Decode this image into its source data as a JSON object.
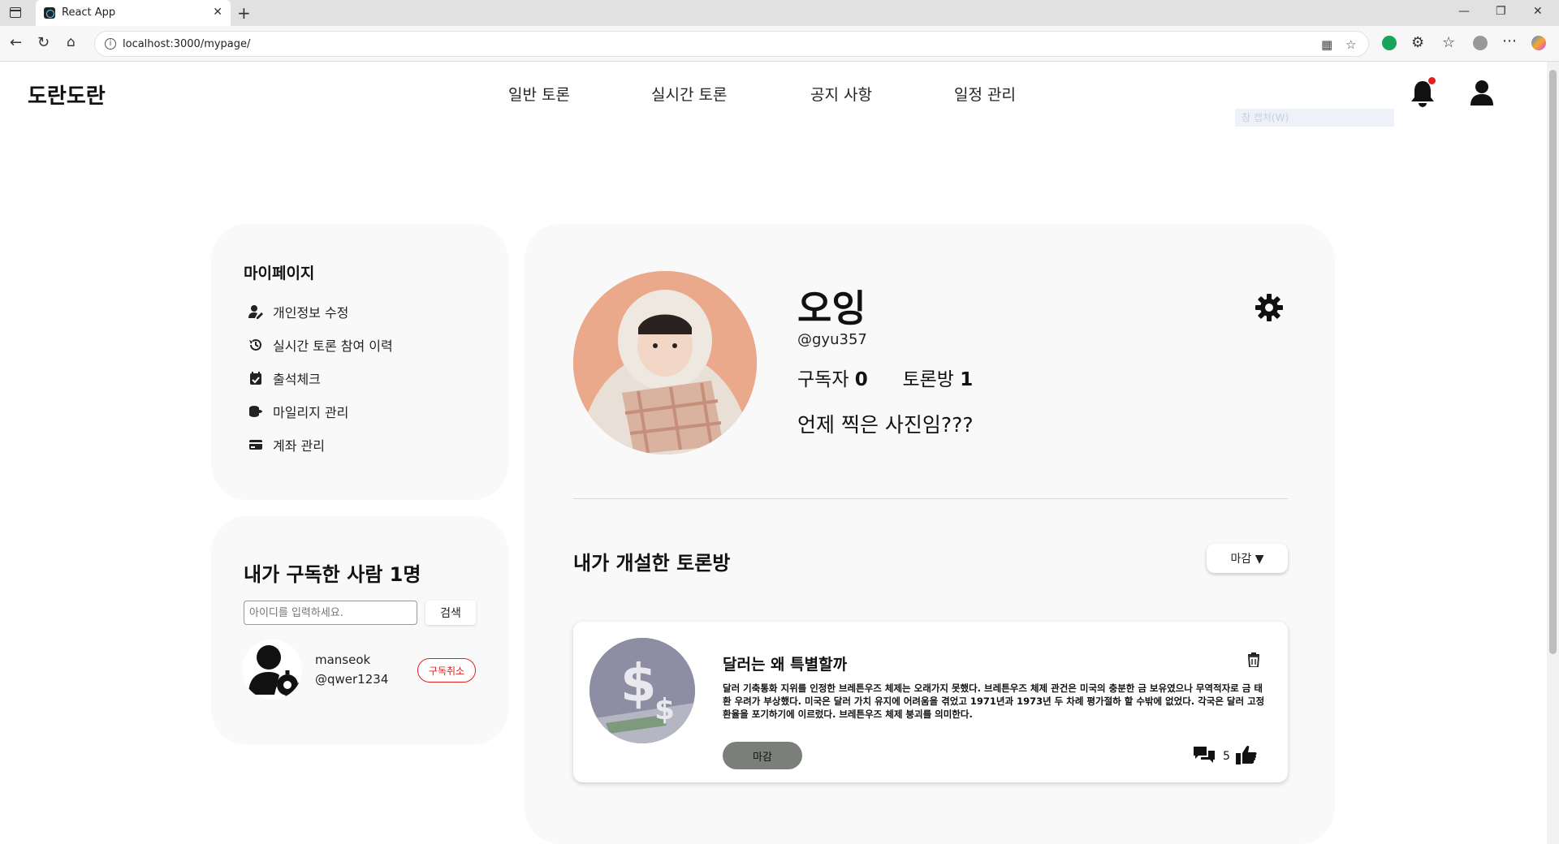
{
  "browser": {
    "tab_title": "React App",
    "tab_close": "✕",
    "new_tab": "+",
    "url": "localhost:3000/mypage/",
    "controls": {
      "minimize": "—",
      "restore": "❐",
      "close": "✕"
    }
  },
  "header": {
    "logo": "도란도란",
    "nav": [
      "일반 토론",
      "실시간 토론",
      "공지 사항",
      "일정 관리"
    ],
    "capture_hint": "창 캡처(W)"
  },
  "sidebar": {
    "title": "마이페이지",
    "items": [
      {
        "label": "개인정보 수정",
        "icon": "user-edit-icon"
      },
      {
        "label": "실시간 토론 참여 이력",
        "icon": "history-icon"
      },
      {
        "label": "출석체크",
        "icon": "calendar-check-icon"
      },
      {
        "label": "마일리지 관리",
        "icon": "coins-icon"
      },
      {
        "label": "계좌 관리",
        "icon": "credit-card-icon"
      }
    ]
  },
  "subscriptions": {
    "title": "내가 구독한 사람 1명",
    "search_placeholder": "아이디를 입력하세요.",
    "search_button": "검색",
    "people": [
      {
        "name": "manseok",
        "handle": "@qwer1234",
        "action": "구독취소"
      }
    ]
  },
  "profile": {
    "name": "오잉",
    "handle": "@gyu357",
    "subscribers_label": "구독자",
    "subscribers": "0",
    "rooms_label": "토론방",
    "rooms": "1",
    "bio": "언제 찍은 사진임???"
  },
  "rooms": {
    "title": "내가 개설한 토론방",
    "sort_label": "마감 ▼",
    "items": [
      {
        "title": "달러는 왜 특별할까",
        "description": "달러 기축통화 지위를 인정한 브레튼우즈 체제는 오래가지 못했다. 브레튼우즈 체제 관건은 미국의 충분한 금 보유였으나 무역적자로 금 태환 우려가 부상했다. 미국은 달러 가치 유지에 어려움을 겪었고 1971년과 1973년 두 차례 평가절하 할 수밖에 없었다. 각국은 달러 고정환율을 포기하기에 이르렀다. 브레튼우즈 체제 붕괴를 의미한다.",
        "status": "마감",
        "comment_count": "5"
      }
    ]
  },
  "colors": {
    "accent_red": "#e02020",
    "card_bg": "#f9f9f9",
    "closed_button": "#7a7f7a"
  }
}
